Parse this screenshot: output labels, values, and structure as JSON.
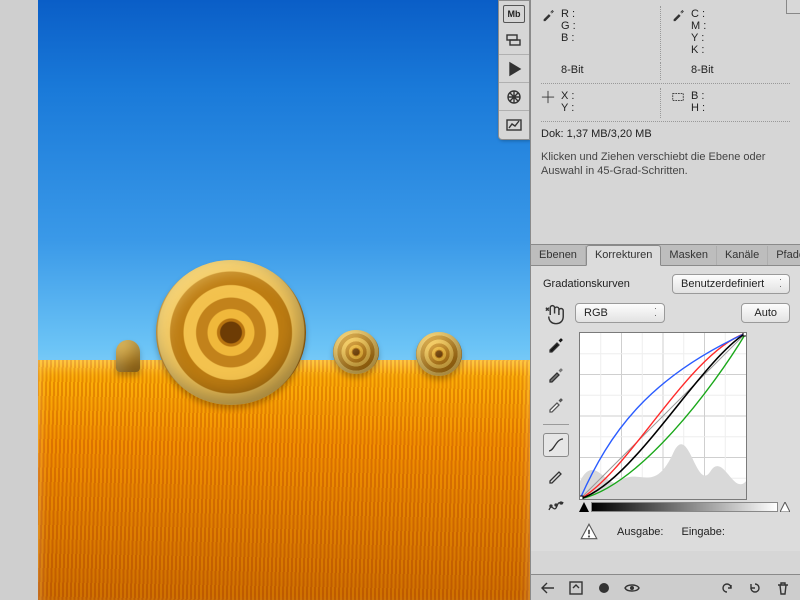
{
  "info": {
    "rgb": {
      "r": "R :",
      "g": "G :",
      "b": "B :"
    },
    "cmyk": {
      "c": "C :",
      "m": "M :",
      "y": "Y :",
      "k": "K :"
    },
    "bit_left": "8-Bit",
    "bit_right": "8-Bit",
    "xy": {
      "x": "X :",
      "y": "Y :"
    },
    "bh": {
      "b": "B :",
      "h": "H :"
    },
    "docsize": "Dok: 1,37 MB/3,20 MB",
    "hint": "Klicken und Ziehen verschiebt die Ebene oder Auswahl in 45-Grad-Schritten."
  },
  "tabs": {
    "ebenen": "Ebenen",
    "korrekturen": "Korrekturen",
    "masken": "Masken",
    "kanaele": "Kanäle",
    "pfade": "Pfade"
  },
  "curves": {
    "title": "Gradationskurven",
    "preset": "Benutzerdefiniert",
    "channel": "RGB",
    "auto": "Auto",
    "output": "Ausgabe:",
    "input": "Eingabe:"
  },
  "icons": {
    "mb": "Mb",
    "layers": "layers-icon",
    "play": "play-icon",
    "wheel": "navigator-icon",
    "photo": "histogram-icon"
  }
}
